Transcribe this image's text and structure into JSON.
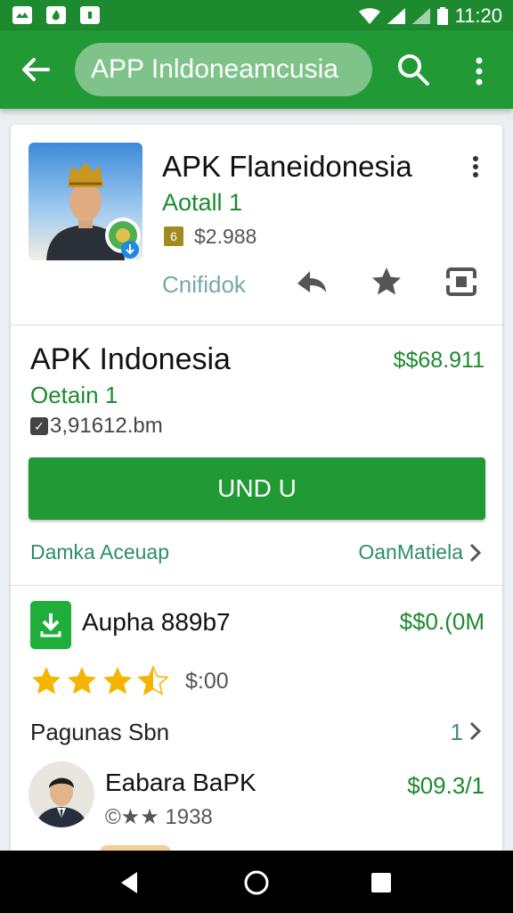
{
  "status_bar": {
    "time": "11:20"
  },
  "app_bar": {
    "search_text": "APP Inldoneamcusia"
  },
  "app_card": {
    "title": "APK Flaneidonesia",
    "subtitle": "Aotall 1",
    "rating_badge": "6",
    "size": "$2.988",
    "unlock_label": "Cnifidok"
  },
  "detail": {
    "title": "APK Indonesia",
    "price": "$$68.911",
    "subtitle": "Oetain 1",
    "size": "3,91612.bm",
    "install_label": "UND  U",
    "link_left": "Damka Aceuap",
    "link_right": "OanMatiela"
  },
  "related": {
    "title": "Aupha 889b7",
    "price": "$$0.(0M",
    "stars_value": 3.5,
    "stars_label": "$:00",
    "pages_label": "Pagunas Sbn",
    "pages_count": "1"
  },
  "developer": {
    "name": "Eabara BaPK",
    "meta": "©★★ 1938",
    "price": "$09.3/1"
  },
  "colors": {
    "brand": "#219a35",
    "accent_text": "#1e8a2f",
    "star": "#f4b400"
  }
}
